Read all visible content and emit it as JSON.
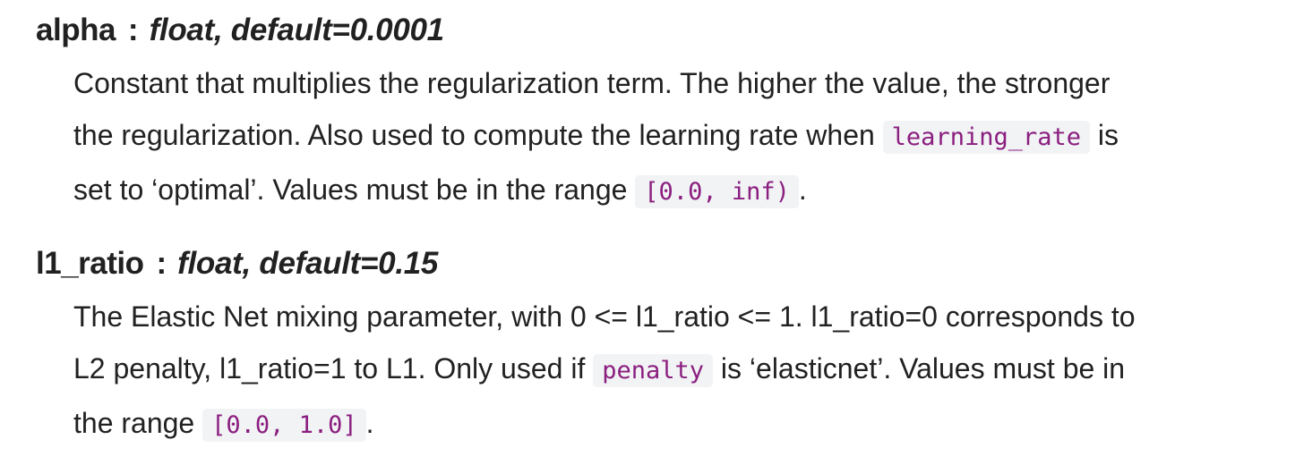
{
  "params": [
    {
      "name": "alpha",
      "separator": ":",
      "type": "float, default=0.0001",
      "lines": [
        {
          "text_before": "Constant that multiplies the regularization term. The higher the value, the stronger"
        },
        {
          "text_before": "the regularization. Also used to compute the learning rate when ",
          "code": "learning_rate",
          "text_after": " is"
        },
        {
          "text_before": "set to ‘optimal’. Values must be in the range ",
          "code": "[0.0, inf)",
          "text_after": "."
        }
      ]
    },
    {
      "name": "l1_ratio",
      "separator": ":",
      "type": "float, default=0.15",
      "lines": [
        {
          "text_before": "The Elastic Net mixing parameter, with 0 <= l1_ratio <= 1. l1_ratio=0 corresponds to"
        },
        {
          "text_before": "L2 penalty, l1_ratio=1 to L1. Only used if ",
          "code": "penalty",
          "text_after": " is ‘elasticnet’. Values must be in"
        },
        {
          "text_before": "the range ",
          "code": "[0.0, 1.0]",
          "text_after": "."
        }
      ]
    }
  ]
}
